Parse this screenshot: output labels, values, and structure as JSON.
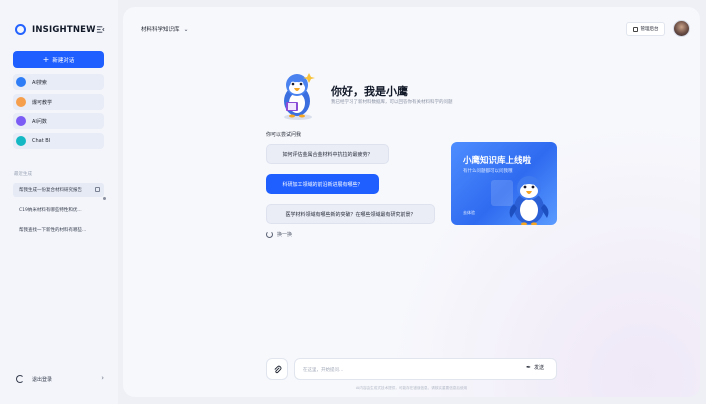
{
  "app": {
    "logo_text": "INSIGHTNEW"
  },
  "sidebar": {
    "new_chat_label": "新建对话",
    "items": [
      {
        "label": "AI搜索",
        "color": "#2f7df6"
      },
      {
        "label": "爆可教学",
        "color": "#f59e4b"
      },
      {
        "label": "AI问数",
        "color": "#7b5cf5"
      },
      {
        "label": "Chat BI",
        "color": "#14b8c4"
      }
    ],
    "recent_title": "最近生成",
    "recent": [
      "帮我生成一份复合材料研究报告",
      "C19纳米材料有哪些特性和优...",
      "帮我查找一下新性的材料有哪些..."
    ],
    "logout_label": "退出登录"
  },
  "header": {
    "kb_select": "材料科学知识库",
    "mgmt_label": "管理后台"
  },
  "welcome": {
    "title": "你好，我是小鹰",
    "subtitle": "我已经学习了新材料数据库，可以回答你有关材料科学的问题"
  },
  "suggestions": {
    "title": "你可以尝试问我",
    "questions": [
      "如何评估金属合金材料中抗拉的最疲劳？",
      "科研加工领域的前沿新进展有哪些？",
      "医学材料领域有哪些新的突破？在哪些领域最有研究前景？"
    ],
    "refresh_label": "换一换"
  },
  "promo": {
    "title": "小鹰知识库上线啦",
    "subtitle": "有什么问题都可以问我哦",
    "cta": "去体验"
  },
  "input": {
    "placeholder": "在这里，开始提问…",
    "send_label": "发送"
  },
  "footer": {
    "disclaimer": "AI内容由生成式技术提供，可能存在错误信息，请核实重要信息后使用"
  }
}
